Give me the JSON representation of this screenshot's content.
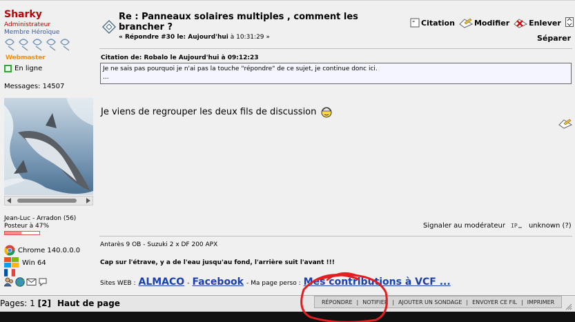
{
  "profile": {
    "username": "Sharky",
    "role": "Administrateur",
    "rank": "Membre Héroïque",
    "team": "Webmaster",
    "status": "En ligne",
    "messages": "Messages: 14507",
    "location": "Jean-Luc - Arradon (56)",
    "rating": "Posteur à 47%",
    "rating_fraction": 0.47,
    "browser": "Chrome 140.0.0.0",
    "os": "Win 64"
  },
  "post": {
    "title": "Re : Panneaux solaires multiples , comment les brancher ?",
    "meta_prefix": "« Répondre #30 le: ",
    "meta_date": "Aujourd'hui",
    "meta_time": " à 10:31:29 »",
    "actions": {
      "quote": "Citation",
      "modify": "Modifier",
      "remove": "Enlever",
      "split": "Séparer"
    },
    "quote_header": "Citation de: Robalo le Aujourd'hui à 09:12:23",
    "quote_line1": "Je ne sais pas pourquoi je n'ai pas la touche \"répondre\" de ce sujet, je continue donc ici.",
    "quote_line2": "...",
    "body": "Je viens de regrouper les deux fils de discussion",
    "report": "Signaler au modérateur",
    "ip": "unknown (?)"
  },
  "signature": {
    "line1": "Antarès 9 OB - Suzuki  2 x DF 200 APX",
    "line2": "Cap sur l'étrave, y a de l'eau jusqu'au fond, l'arrière suit l'avant !!!",
    "sites_label": "Sites WEB :",
    "link1": "ALMACO",
    "dash": "-",
    "link2": "Facebook",
    "perso_label": "- Ma page perso :",
    "link3": "Mes contributions à  VCF ..."
  },
  "footer": {
    "pages_label": "Pages: 1",
    "current_page": "[2]",
    "top": "Haut de page",
    "buttons": [
      "RÉPONDRE",
      "NOTIFIER",
      "AJOUTER UN SONDAGE",
      "ENVOYER CE FIL",
      "IMPRIMER"
    ]
  },
  "colors": {
    "username": "#c00000",
    "rank": "#3b5a99",
    "team": "#ff8c00",
    "link": "#1b3fae",
    "annotation": "#e02020"
  }
}
